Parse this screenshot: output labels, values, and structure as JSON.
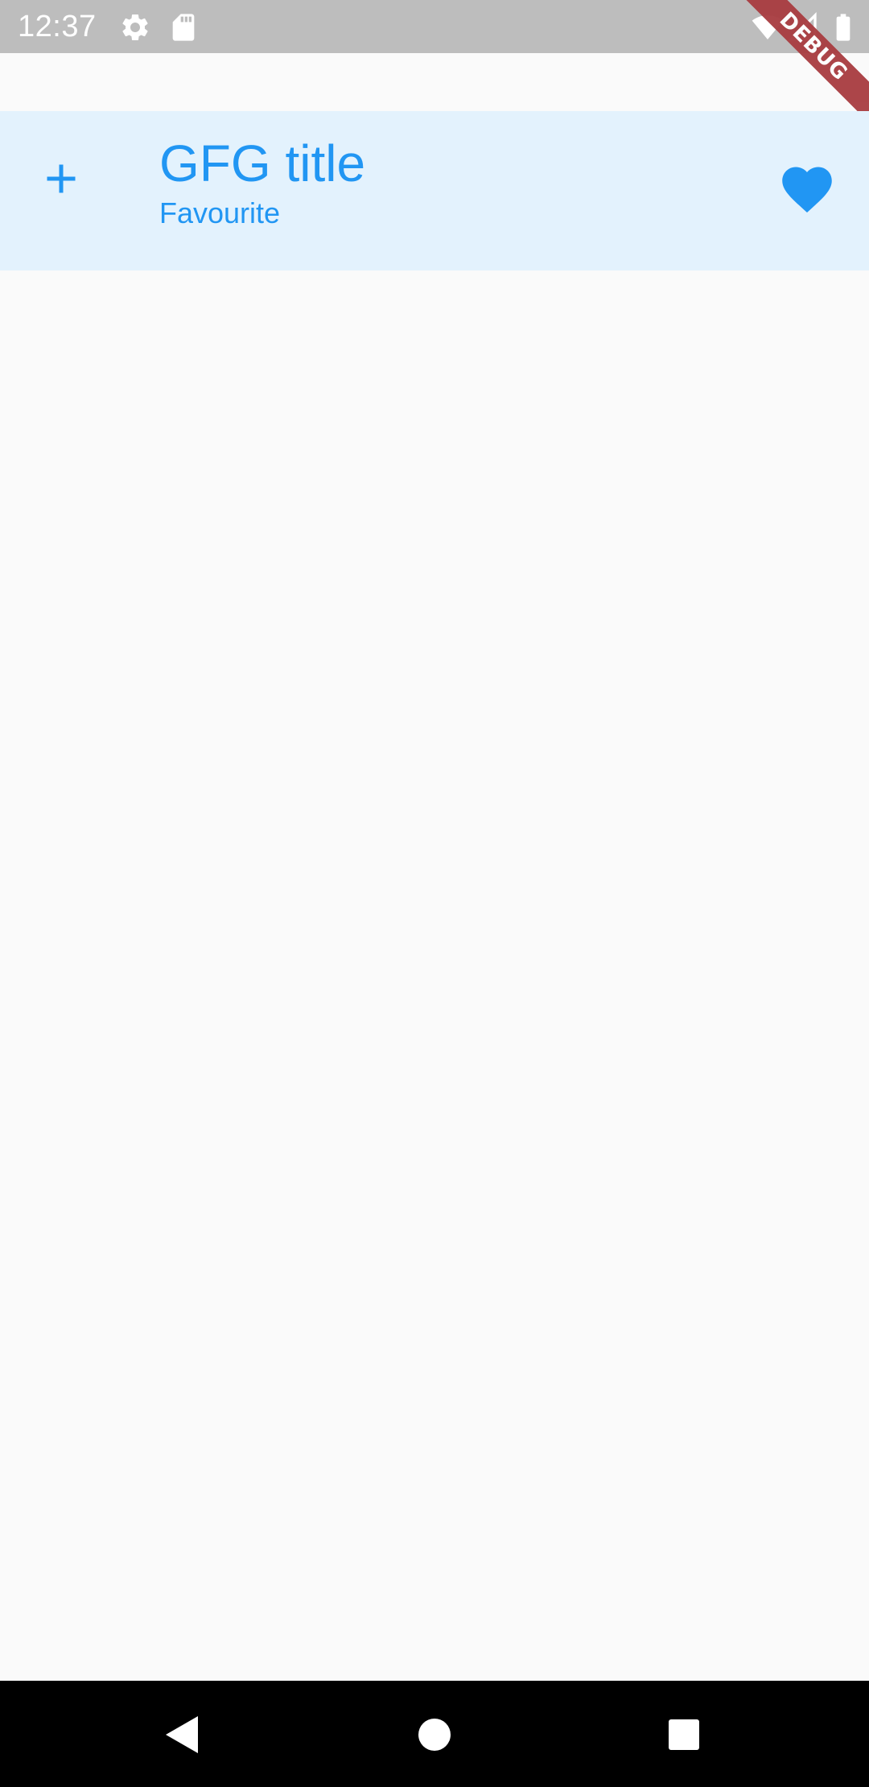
{
  "status_bar": {
    "time": "12:37",
    "icons": [
      "gear-icon",
      "sd-card-icon",
      "wifi-icon",
      "signal-icon",
      "battery-icon"
    ]
  },
  "debug_banner": {
    "label": "DEBUG",
    "color": "#a83c40"
  },
  "list_tile": {
    "title": "GFG title",
    "subtitle": "Favourite",
    "leading_icon": "add-icon",
    "trailing_icon": "heart-icon",
    "tile_color": "#e3f2fd",
    "accent_color": "#2196f3"
  },
  "navigation_bar": {
    "buttons": [
      "back-icon",
      "home-icon",
      "recents-icon"
    ]
  }
}
